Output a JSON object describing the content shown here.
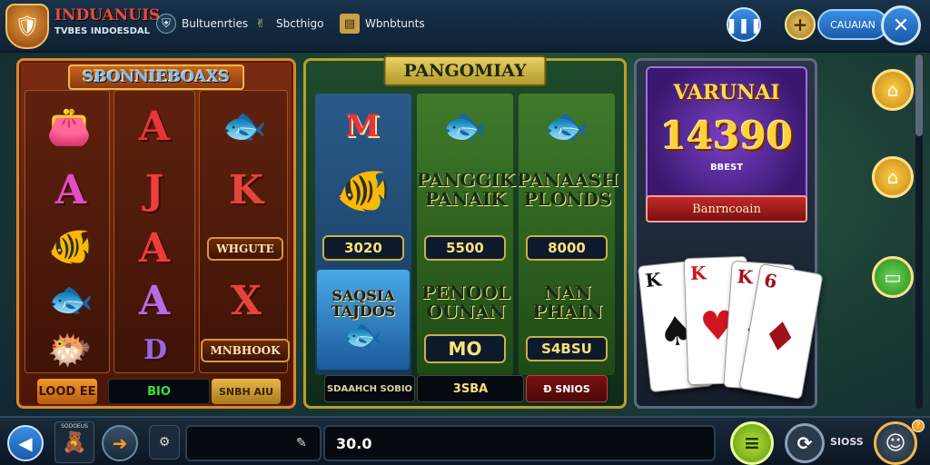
{
  "header": {
    "brand_line1": "INDUANUIS",
    "brand_line2": "TVBES INDOESDAL",
    "nav": [
      {
        "label": "Bultuenrties",
        "icon": "shield-icon"
      },
      {
        "label": "Sbcthigo",
        "icon": "hand-icon"
      },
      {
        "label": "Wbnbtunts",
        "icon": "ticket-icon"
      }
    ],
    "signin_label": "CAUAIAN"
  },
  "panel1": {
    "title": "SBONNIEBOAXS",
    "symbols": [
      [
        "fish-icon",
        "A",
        "fish-icon"
      ],
      [
        "A",
        "J",
        "K"
      ],
      [
        "fish-icon",
        "A",
        "WHGUTE"
      ],
      [
        "fish-icon",
        "A",
        "X"
      ],
      [
        "fish-icon",
        "D",
        "MNBHOOK"
      ]
    ],
    "bottom": [
      "LOOD EE",
      "BIO",
      "SNBH AIU"
    ]
  },
  "panel2": {
    "title": "PANGOMIAY",
    "row2": [
      "PANGGIK PANAIK",
      "PANAASH PLONDS"
    ],
    "amounts": [
      "3020",
      "5500",
      "8000"
    ],
    "row3": [
      "SAQSIA TAJDOS",
      "PENOOL OUNAN",
      "NAN PHAIN"
    ],
    "amounts2": [
      "MO",
      "S4BSU"
    ],
    "bottom": [
      "SDAAHCH SOBIO",
      "3SBA",
      "Ð SNIOS"
    ]
  },
  "panel3": {
    "promo_title": "VARUNAI",
    "promo_number": "14390",
    "promo_sub": "BBEST",
    "promo_bar": "Banrncoain",
    "cards": [
      {
        "rank": "K",
        "suit": "♠",
        "color": "#111111"
      },
      {
        "rank": "K",
        "suit": "♥",
        "color": "#d1141e"
      },
      {
        "rank": "K",
        "suit": "♦",
        "color": "#a0101a"
      },
      {
        "rank": "6",
        "suit": "♦",
        "color": "#a0101a"
      }
    ]
  },
  "bottombar": {
    "avatar_label": "SODOEUS",
    "amount": "30.0",
    "right_label": "SIOSS"
  },
  "colors": {
    "accent_gold": "#f3c35a",
    "panel1_border": "#d98a2a",
    "panel2_border": "#b8a02a",
    "promo_purple": "#7b3fc8"
  }
}
